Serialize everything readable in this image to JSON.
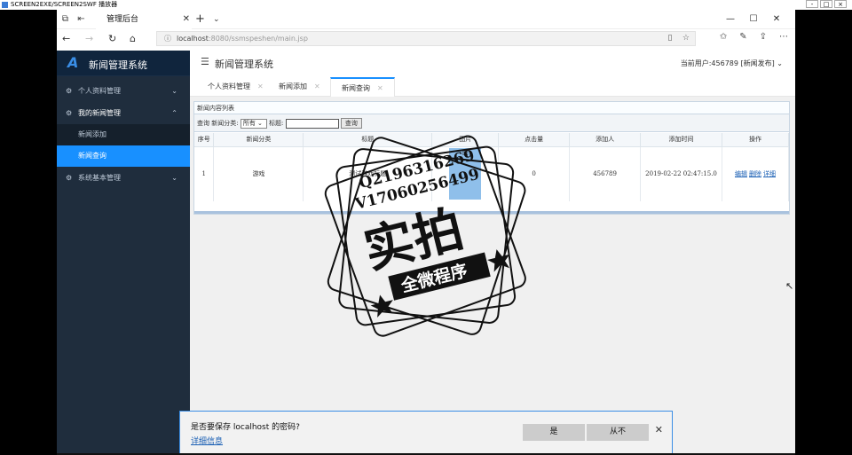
{
  "outer_window": {
    "title": "SCREEN2EXE/SCREEN2SWF 播放器",
    "controls": [
      "-",
      "□",
      "×"
    ]
  },
  "browser": {
    "tab_title": "管理后台",
    "new_tab": "+",
    "tab_list": "⌄",
    "window_controls": [
      "—",
      "☐",
      "✕"
    ],
    "address": {
      "host": "localhost",
      "rest": ":8080/ssmspeshen/main.jsp"
    }
  },
  "sidebar": {
    "logo_mark": "A",
    "app_name": "新闻管理系统",
    "items": [
      {
        "label": "个人资料管理",
        "arrow": "⌄"
      },
      {
        "label": "我的新闻管理",
        "arrow": "⌃",
        "children": [
          "新闻添加",
          "新闻查询"
        ]
      },
      {
        "label": "系统基本管理",
        "arrow": "⌄"
      }
    ]
  },
  "header": {
    "title": "新闻管理系统",
    "user": "当前用户:456789 [新闻发布] ⌄"
  },
  "page_tabs": [
    "个人资料管理",
    "新闻添加",
    "新闻查询"
  ],
  "panel": {
    "title": "新闻内容列表",
    "search": {
      "category_label": "查询 新闻分类:",
      "category_value": "所有",
      "title_label": "标题:",
      "button": "查询"
    },
    "columns": [
      "序号",
      "新闻分类",
      "标题",
      "图片",
      "点击量",
      "添加人",
      "添加时间",
      "操作"
    ],
    "rows": [
      {
        "no": "1",
        "category": "游戏",
        "title": "测试游戏标题",
        "image_alt": "图",
        "clicks": "0",
        "adder": "456789",
        "time": "2019-02-22 02:47:15.0",
        "ops": [
          "编辑",
          "删除",
          "详细"
        ]
      }
    ]
  },
  "watermark": {
    "line1": "Q2196316269",
    "line2": "V17060256499",
    "big": "实拍",
    "ribbon": "全微程序"
  },
  "save_prompt": {
    "question": "是否要保存 localhost 的密码?",
    "details": "详细信息",
    "yes": "是",
    "never": "从不",
    "close": "✕"
  }
}
